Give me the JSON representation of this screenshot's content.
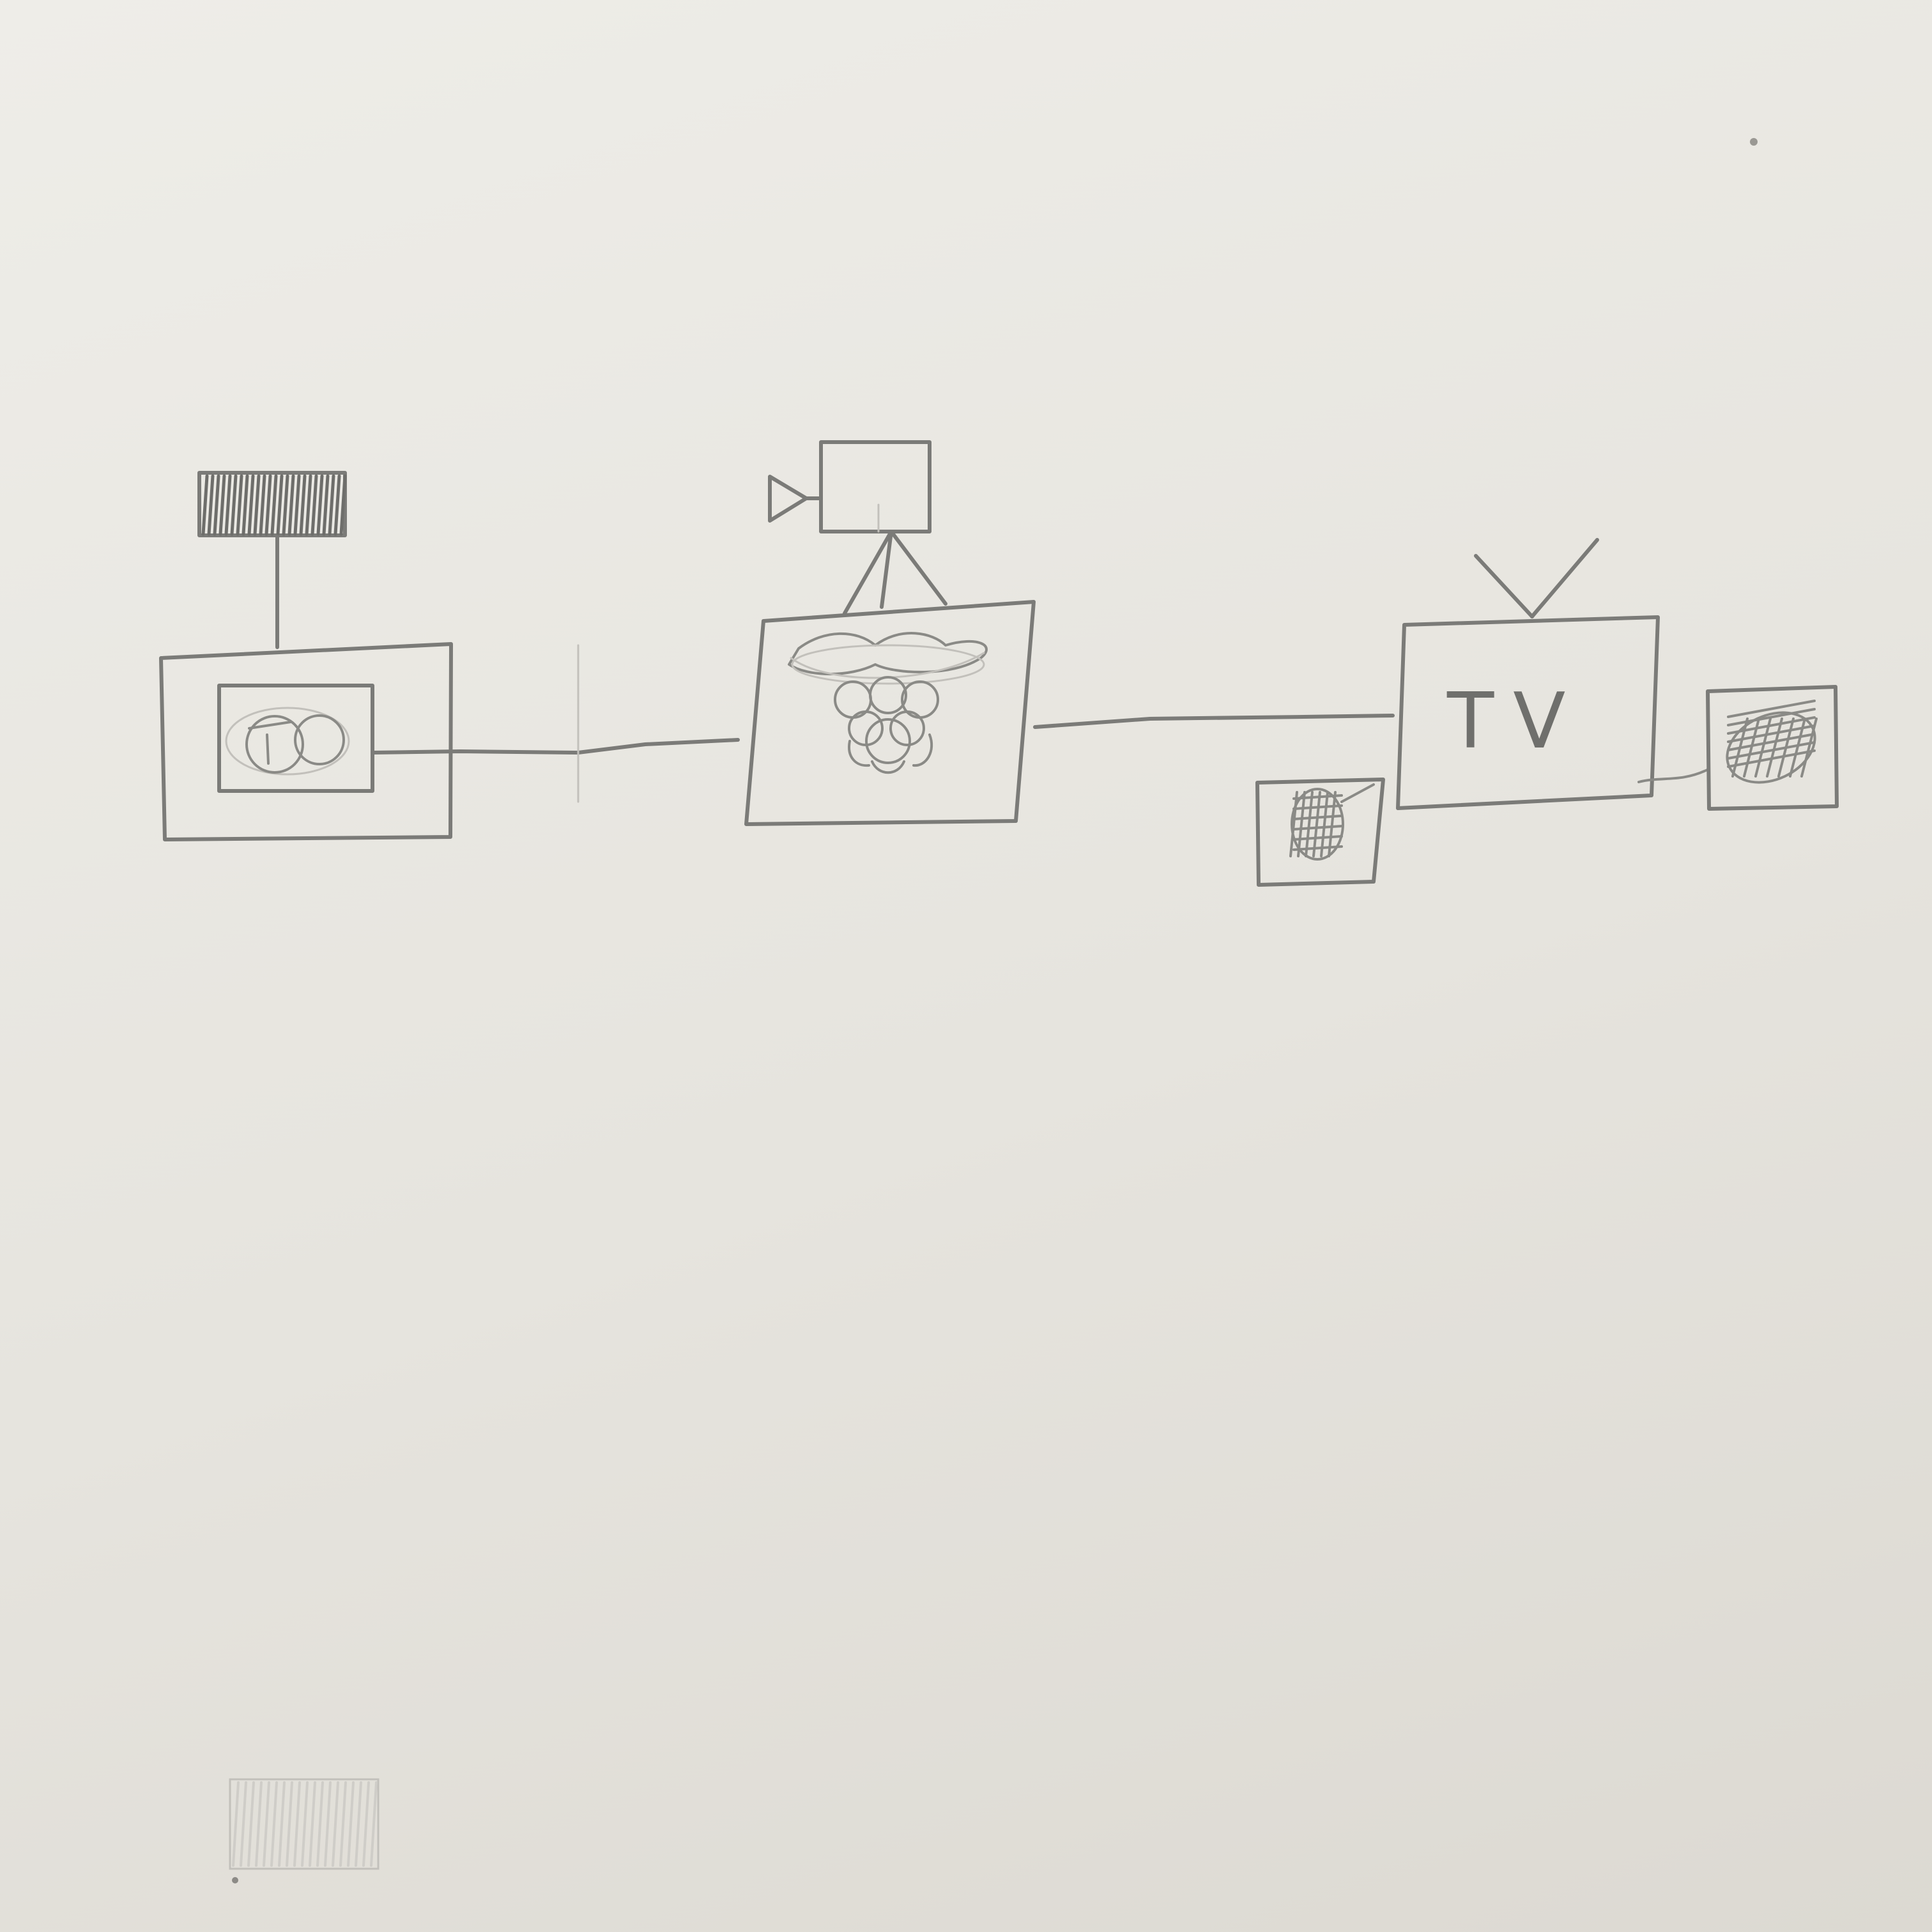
{
  "diagram": {
    "tv_label": "TV",
    "nodes": [
      {
        "id": "receiver",
        "icon": "set-top-box-with-antenna"
      },
      {
        "id": "raspberry-pi",
        "icon": "raspberry-pi-with-camera"
      },
      {
        "id": "television",
        "icon": "tv-with-speakers"
      }
    ],
    "edges": [
      {
        "from": "receiver",
        "to": "raspberry-pi"
      },
      {
        "from": "raspberry-pi",
        "to": "television"
      },
      {
        "from": "television",
        "to": "right-speaker"
      }
    ]
  },
  "colors": {
    "paper": "#e9e7e1",
    "pencil": "#7b7b78"
  }
}
